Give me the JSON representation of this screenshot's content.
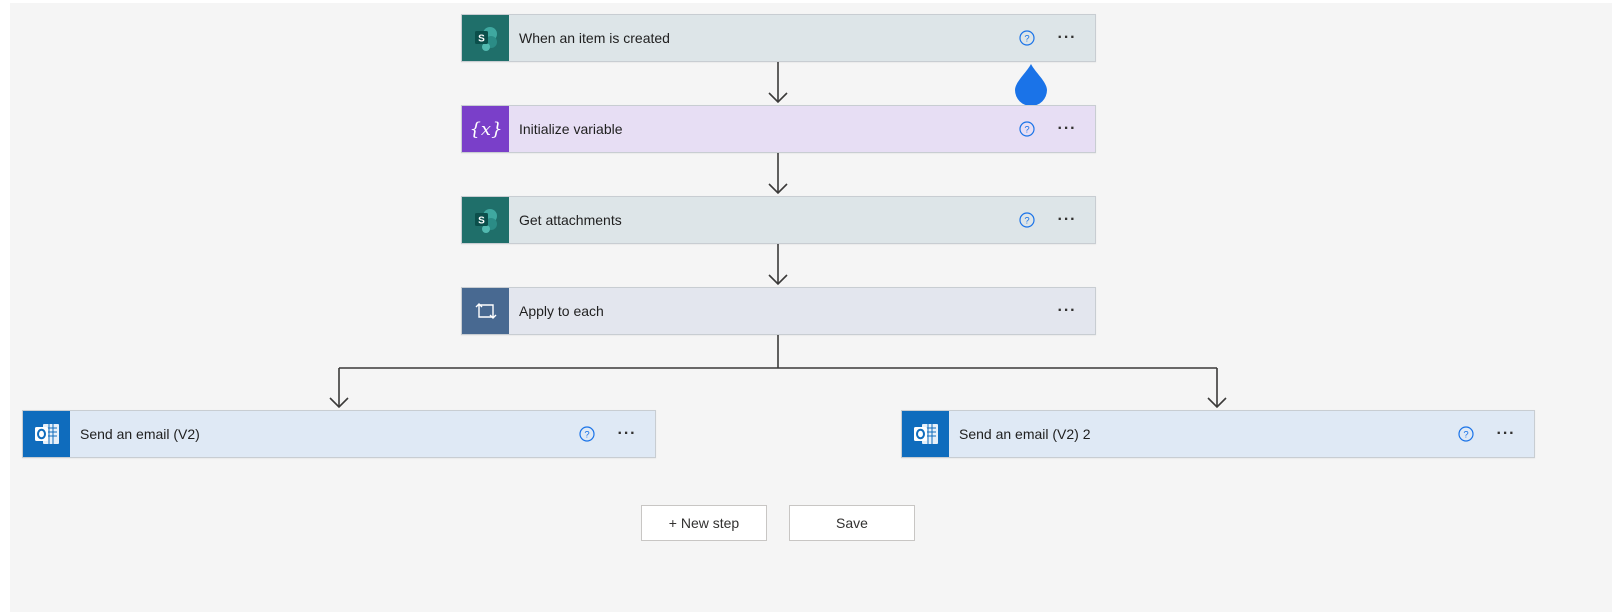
{
  "steps": {
    "trigger": {
      "title": "When an item is created",
      "icon": "sharepoint-icon"
    },
    "init_var": {
      "title": "Initialize variable",
      "icon": "variable-icon"
    },
    "get_attachments": {
      "title": "Get attachments",
      "icon": "sharepoint-icon"
    },
    "apply_each": {
      "title": "Apply to each",
      "icon": "loop-icon"
    },
    "email_left": {
      "title": "Send an email (V2)",
      "icon": "outlook-icon"
    },
    "email_right": {
      "title": "Send an email (V2) 2",
      "icon": "outlook-icon"
    }
  },
  "card_actions": {
    "help": "help-icon",
    "more": "···"
  },
  "buttons": {
    "new_step": "+ New step",
    "save": "Save"
  },
  "colors": {
    "sharepoint": "#1f6f6a",
    "variable": "#7a3fc9",
    "loop": "#486991",
    "outlook": "#0f6cbd",
    "accent_drop": "#1a73e8"
  }
}
